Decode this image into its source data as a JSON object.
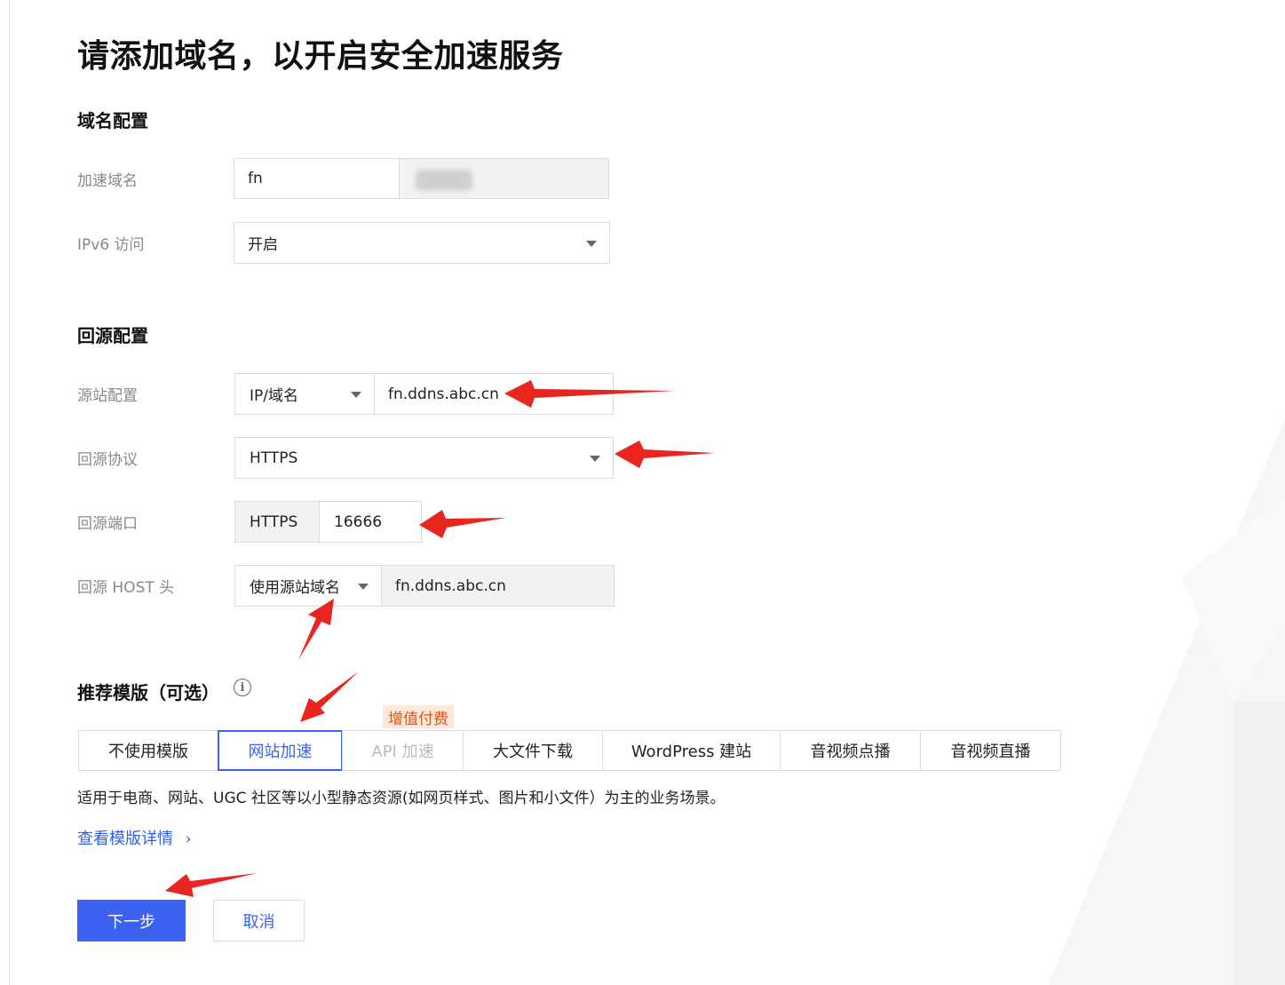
{
  "page_title": "请添加域名，以开启安全加速服务",
  "domain_section": {
    "title": "域名配置",
    "accel_domain_label": "加速域名",
    "accel_domain_value": "fn",
    "ipv6_label": "IPv6 访问",
    "ipv6_value": "开启"
  },
  "origin_section": {
    "title": "回源配置",
    "origin_label": "源站配置",
    "origin_type": "IP/域名",
    "origin_value": "fn.ddns.abc.cn",
    "protocol_label": "回源协议",
    "protocol_value": "HTTPS",
    "port_label": "回源端口",
    "port_prefix": "HTTPS",
    "port_value": "16666",
    "host_label": "回源 HOST 头",
    "host_type": "使用源站域名",
    "host_value": "fn.ddns.abc.cn"
  },
  "template_section": {
    "title": "推荐模版（可选）",
    "badge": "增值付费",
    "tabs": [
      {
        "label": "不使用模版"
      },
      {
        "label": "网站加速"
      },
      {
        "label": "API 加速"
      },
      {
        "label": "大文件下载"
      },
      {
        "label": "WordPress 建站"
      },
      {
        "label": "音视频点播"
      },
      {
        "label": "音视频直播"
      }
    ],
    "active_tab": "网站加速",
    "disabled_tab": "API 加速",
    "description": "适用于电商、网站、UGC 社区等以小型静态资源(如网页样式、图片和小文件）为主的业务场景。",
    "details_link": "查看模版详情"
  },
  "actions": {
    "next_label": "下一步",
    "cancel_label": "取消"
  },
  "colors": {
    "primary": "#3d61f0",
    "badge_bg": "#fde7d8",
    "badge_text": "#d9531e",
    "annotation_arrow": "#e8251f"
  },
  "icons": [
    "info-icon",
    "chevron-down-icon",
    "chevron-right-icon"
  ]
}
